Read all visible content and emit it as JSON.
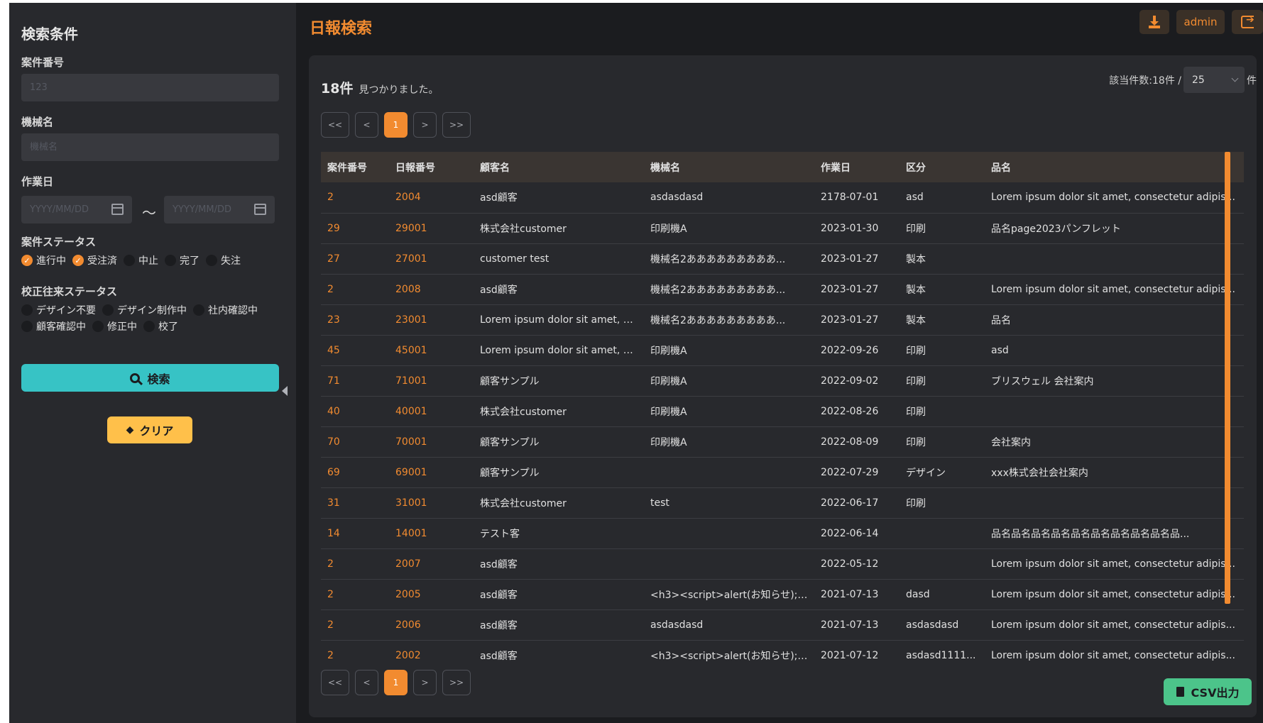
{
  "sidebar": {
    "title": "検索条件",
    "case_no_label": "案件番号",
    "case_no_placeholder": "123",
    "machine_label": "機械名",
    "machine_placeholder": "機械名",
    "work_date_label": "作業日",
    "date_placeholder": "YYYY/MM/DD",
    "date_sep": "～",
    "case_status_label": "案件ステータス",
    "case_statuses": [
      {
        "label": "進行中",
        "checked": true
      },
      {
        "label": "受注済",
        "checked": true
      },
      {
        "label": "中止",
        "checked": false
      },
      {
        "label": "完了",
        "checked": false
      },
      {
        "label": "失注",
        "checked": false
      }
    ],
    "proof_status_label": "校正往来ステータス",
    "proof_statuses_row1": [
      "デザイン不要",
      "デザイン制作中",
      "社内確認中"
    ],
    "proof_statuses_row2": [
      "顧客確認中",
      "修正中",
      "校了"
    ],
    "search_button": "検索",
    "clear_button": "クリア"
  },
  "header": {
    "title": "日報検索",
    "user": "admin",
    "download_icon": "download-icon",
    "logout_icon": "logout-icon"
  },
  "results": {
    "count": "18件",
    "found_text": "見つかりました。",
    "total_label": "該当件数:18件 /",
    "per_page": "25",
    "per_page_unit": "件",
    "pager": {
      "first": "<<",
      "prev": "<",
      "current": "1",
      "next": ">",
      "last": ">>"
    },
    "columns": [
      "案件番号",
      "日報番号",
      "顧客名",
      "機械名",
      "作業日",
      "区分",
      "品名"
    ],
    "rows": [
      [
        "2",
        "2004",
        "asd顧客",
        "asdasdasd",
        "2178-07-01",
        "asd",
        "Lorem ipsum dolor sit amet, consectetur adipis..."
      ],
      [
        "29",
        "29001",
        "株式会社customer",
        "印刷機A",
        "2023-01-30",
        "印刷",
        "品名page2023パンフレット"
      ],
      [
        "27",
        "27001",
        "customer test",
        "機械名2あああああああああ...",
        "2023-01-27",
        "製本",
        ""
      ],
      [
        "2",
        "2008",
        "asd顧客",
        "機械名2あああああああああ...",
        "2023-01-27",
        "製本",
        "Lorem ipsum dolor sit amet, consectetur adipis..."
      ],
      [
        "23",
        "23001",
        "Lorem ipsum dolor sit amet, c...",
        "機械名2あああああああああ...",
        "2023-01-27",
        "製本",
        "品名"
      ],
      [
        "45",
        "45001",
        "Lorem ipsum dolor sit amet, c...",
        "印刷機A",
        "2022-09-26",
        "印刷",
        "asd"
      ],
      [
        "71",
        "71001",
        "顧客サンプル",
        "印刷機A",
        "2022-09-02",
        "印刷",
        "ブリスウェル 会社案内"
      ],
      [
        "40",
        "40001",
        "株式会社customer",
        "印刷機A",
        "2022-08-26",
        "印刷",
        ""
      ],
      [
        "70",
        "70001",
        "顧客サンプル",
        "印刷機A",
        "2022-08-09",
        "印刷",
        "会社案内"
      ],
      [
        "69",
        "69001",
        "顧客サンプル",
        "",
        "2022-07-29",
        "デザイン",
        "xxx株式会社会社案内"
      ],
      [
        "31",
        "31001",
        "株式会社customer",
        "test",
        "2022-06-17",
        "印刷",
        ""
      ],
      [
        "14",
        "14001",
        "テスト客",
        "",
        "2022-06-14",
        "",
        "品名品名品名品名品名品名品名品名品名品..."
      ],
      [
        "2",
        "2007",
        "asd顧客",
        "",
        "2022-05-12",
        "",
        "Lorem ipsum dolor sit amet, consectetur adipis..."
      ],
      [
        "2",
        "2005",
        "asd顧客",
        "<h3><script>alert(お知らせ);<...",
        "2021-07-13",
        "dasd",
        "Lorem ipsum dolor sit amet, consectetur adipis..."
      ],
      [
        "2",
        "2006",
        "asd顧客",
        "asdasdasd",
        "2021-07-13",
        "asdasdasd",
        "Lorem ipsum dolor sit amet, consectetur adipis..."
      ],
      [
        "2",
        "2002",
        "asd顧客",
        "<h3><script>alert(お知らせ);<...",
        "2021-07-12",
        "asdasd1111...",
        "Lorem ipsum dolor sit amet, consectetur adipis..."
      ]
    ],
    "csv_button": "CSV出力"
  },
  "colors": {
    "accent": "#f28b30",
    "search": "#37c3c5",
    "clear": "#ffc04a",
    "csv": "#4cc48a"
  }
}
